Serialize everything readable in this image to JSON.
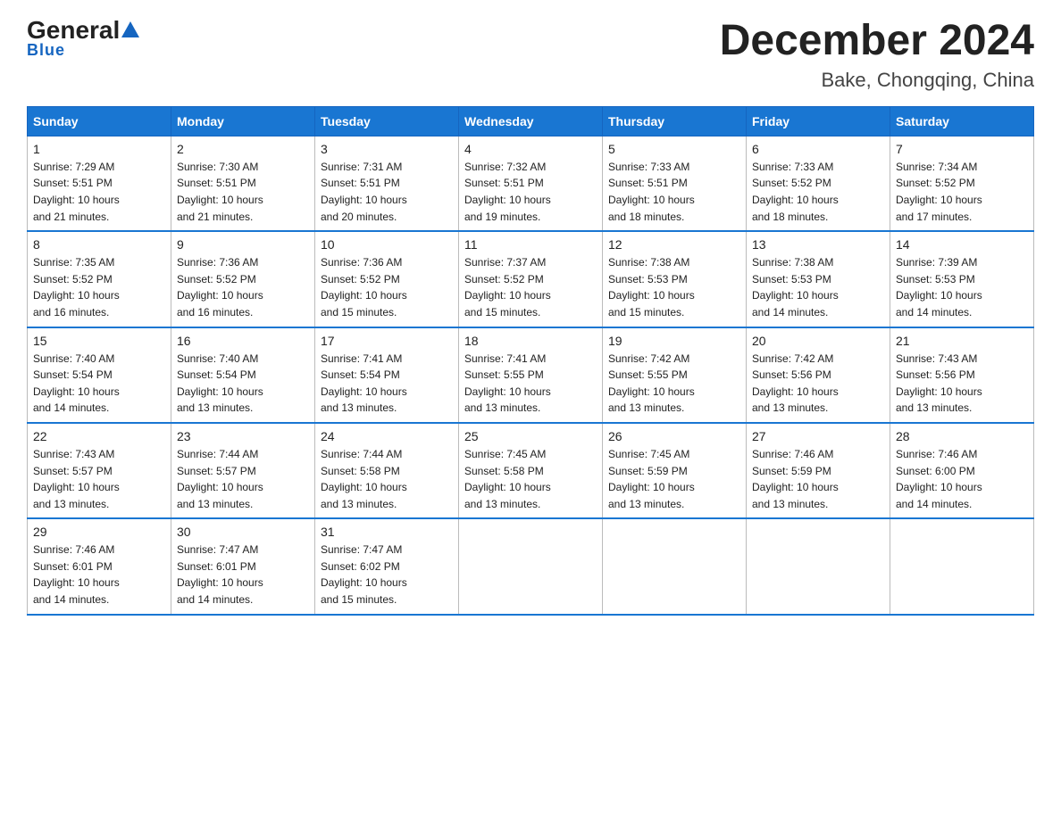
{
  "logo": {
    "general": "General",
    "blue": "Blue",
    "tagline": "Blue"
  },
  "title": "December 2024",
  "subtitle": "Bake, Chongqing, China",
  "days_header": [
    "Sunday",
    "Monday",
    "Tuesday",
    "Wednesday",
    "Thursday",
    "Friday",
    "Saturday"
  ],
  "weeks": [
    [
      {
        "day": "1",
        "sunrise": "7:29 AM",
        "sunset": "5:51 PM",
        "daylight": "10 hours and 21 minutes."
      },
      {
        "day": "2",
        "sunrise": "7:30 AM",
        "sunset": "5:51 PM",
        "daylight": "10 hours and 21 minutes."
      },
      {
        "day": "3",
        "sunrise": "7:31 AM",
        "sunset": "5:51 PM",
        "daylight": "10 hours and 20 minutes."
      },
      {
        "day": "4",
        "sunrise": "7:32 AM",
        "sunset": "5:51 PM",
        "daylight": "10 hours and 19 minutes."
      },
      {
        "day": "5",
        "sunrise": "7:33 AM",
        "sunset": "5:51 PM",
        "daylight": "10 hours and 18 minutes."
      },
      {
        "day": "6",
        "sunrise": "7:33 AM",
        "sunset": "5:52 PM",
        "daylight": "10 hours and 18 minutes."
      },
      {
        "day": "7",
        "sunrise": "7:34 AM",
        "sunset": "5:52 PM",
        "daylight": "10 hours and 17 minutes."
      }
    ],
    [
      {
        "day": "8",
        "sunrise": "7:35 AM",
        "sunset": "5:52 PM",
        "daylight": "10 hours and 16 minutes."
      },
      {
        "day": "9",
        "sunrise": "7:36 AM",
        "sunset": "5:52 PM",
        "daylight": "10 hours and 16 minutes."
      },
      {
        "day": "10",
        "sunrise": "7:36 AM",
        "sunset": "5:52 PM",
        "daylight": "10 hours and 15 minutes."
      },
      {
        "day": "11",
        "sunrise": "7:37 AM",
        "sunset": "5:52 PM",
        "daylight": "10 hours and 15 minutes."
      },
      {
        "day": "12",
        "sunrise": "7:38 AM",
        "sunset": "5:53 PM",
        "daylight": "10 hours and 15 minutes."
      },
      {
        "day": "13",
        "sunrise": "7:38 AM",
        "sunset": "5:53 PM",
        "daylight": "10 hours and 14 minutes."
      },
      {
        "day": "14",
        "sunrise": "7:39 AM",
        "sunset": "5:53 PM",
        "daylight": "10 hours and 14 minutes."
      }
    ],
    [
      {
        "day": "15",
        "sunrise": "7:40 AM",
        "sunset": "5:54 PM",
        "daylight": "10 hours and 14 minutes."
      },
      {
        "day": "16",
        "sunrise": "7:40 AM",
        "sunset": "5:54 PM",
        "daylight": "10 hours and 13 minutes."
      },
      {
        "day": "17",
        "sunrise": "7:41 AM",
        "sunset": "5:54 PM",
        "daylight": "10 hours and 13 minutes."
      },
      {
        "day": "18",
        "sunrise": "7:41 AM",
        "sunset": "5:55 PM",
        "daylight": "10 hours and 13 minutes."
      },
      {
        "day": "19",
        "sunrise": "7:42 AM",
        "sunset": "5:55 PM",
        "daylight": "10 hours and 13 minutes."
      },
      {
        "day": "20",
        "sunrise": "7:42 AM",
        "sunset": "5:56 PM",
        "daylight": "10 hours and 13 minutes."
      },
      {
        "day": "21",
        "sunrise": "7:43 AM",
        "sunset": "5:56 PM",
        "daylight": "10 hours and 13 minutes."
      }
    ],
    [
      {
        "day": "22",
        "sunrise": "7:43 AM",
        "sunset": "5:57 PM",
        "daylight": "10 hours and 13 minutes."
      },
      {
        "day": "23",
        "sunrise": "7:44 AM",
        "sunset": "5:57 PM",
        "daylight": "10 hours and 13 minutes."
      },
      {
        "day": "24",
        "sunrise": "7:44 AM",
        "sunset": "5:58 PM",
        "daylight": "10 hours and 13 minutes."
      },
      {
        "day": "25",
        "sunrise": "7:45 AM",
        "sunset": "5:58 PM",
        "daylight": "10 hours and 13 minutes."
      },
      {
        "day": "26",
        "sunrise": "7:45 AM",
        "sunset": "5:59 PM",
        "daylight": "10 hours and 13 minutes."
      },
      {
        "day": "27",
        "sunrise": "7:46 AM",
        "sunset": "5:59 PM",
        "daylight": "10 hours and 13 minutes."
      },
      {
        "day": "28",
        "sunrise": "7:46 AM",
        "sunset": "6:00 PM",
        "daylight": "10 hours and 14 minutes."
      }
    ],
    [
      {
        "day": "29",
        "sunrise": "7:46 AM",
        "sunset": "6:01 PM",
        "daylight": "10 hours and 14 minutes."
      },
      {
        "day": "30",
        "sunrise": "7:47 AM",
        "sunset": "6:01 PM",
        "daylight": "10 hours and 14 minutes."
      },
      {
        "day": "31",
        "sunrise": "7:47 AM",
        "sunset": "6:02 PM",
        "daylight": "10 hours and 15 minutes."
      },
      null,
      null,
      null,
      null
    ]
  ],
  "labels": {
    "sunrise": "Sunrise:",
    "sunset": "Sunset:",
    "daylight": "Daylight:"
  }
}
